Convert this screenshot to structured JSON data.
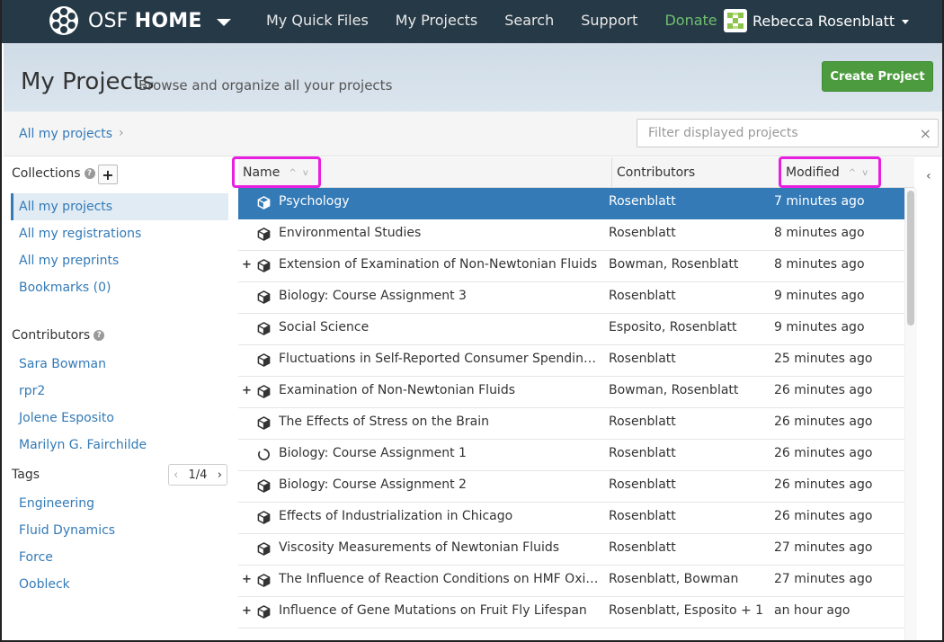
{
  "navbar": {
    "brand_prefix": "OSF ",
    "brand_strong": "HOME",
    "links": [
      "My Quick Files",
      "My Projects",
      "Search",
      "Support",
      "Donate"
    ],
    "user_name": "Rebecca Rosenblatt",
    "bg_color": "#263947",
    "donate_color": "#6fbf6f"
  },
  "header": {
    "title": "My Projects",
    "subtitle": "Browse and organize all your projects",
    "create_button": "Create Project",
    "create_color": "#4c9c3f"
  },
  "breadcrumb": {
    "current": "All my projects",
    "arrow": "›"
  },
  "filter": {
    "placeholder": "Filter displayed projects",
    "value": "",
    "clear_icon": "×"
  },
  "sidebar": {
    "collections_title": "Collections",
    "help_icon": "?",
    "add_icon": "+",
    "collections": [
      "All my projects",
      "All my registrations",
      "All my preprints",
      "Bookmarks (0)"
    ],
    "contributors_title": "Contributors",
    "contributors": [
      "Sara Bowman",
      "rpr2",
      "Jolene Esposito",
      "Marilyn G. Fairchilde"
    ],
    "tags_title": "Tags",
    "tags_pager": "1/4",
    "pager_prev": "‹",
    "pager_next": "›",
    "tags": [
      "Engineering",
      "Fluid Dynamics",
      "Force",
      "Oobleck"
    ]
  },
  "table": {
    "headers": {
      "name": "Name",
      "contributors": "Contributors",
      "modified": "Modified",
      "sort_icons": "^ v"
    },
    "collapse_icon": "‹",
    "highlight_color": "#e81ee0",
    "rows": [
      {
        "name": "Psychology",
        "contributors": "Rosenblatt",
        "modified": "7 minutes ago",
        "expand": "",
        "icon": "cube-icon",
        "selected": true
      },
      {
        "name": "Environmental Studies",
        "contributors": "Rosenblatt",
        "modified": "8 minutes ago",
        "expand": "",
        "icon": "cube-icon"
      },
      {
        "name": "Extension of Examination of Non-Newtonian Fluids",
        "contributors": "Bowman, Rosenblatt",
        "modified": "8 minutes ago",
        "expand": "+",
        "icon": "cube-icon"
      },
      {
        "name": "Biology: Course Assignment 3",
        "contributors": "Rosenblatt",
        "modified": "9 minutes ago",
        "expand": "",
        "icon": "cube-icon"
      },
      {
        "name": "Social Science",
        "contributors": "Esposito, Rosenblatt",
        "modified": "9 minutes ago",
        "expand": "",
        "icon": "cube-icon"
      },
      {
        "name": "Fluctuations in Self-Reported Consumer Spending in ...",
        "contributors": "Rosenblatt",
        "modified": "25 minutes ago",
        "expand": "",
        "icon": "cube-icon"
      },
      {
        "name": "Examination of Non-Newtonian Fluids",
        "contributors": "Bowman, Rosenblatt",
        "modified": "26 minutes ago",
        "expand": "+",
        "icon": "cube-icon"
      },
      {
        "name": "The Effects of Stress on the Brain",
        "contributors": "Rosenblatt",
        "modified": "26 minutes ago",
        "expand": "",
        "icon": "cube-icon"
      },
      {
        "name": "Biology: Course Assignment 1",
        "contributors": "Rosenblatt",
        "modified": "26 minutes ago",
        "expand": "",
        "icon": "loading-ring-icon"
      },
      {
        "name": "Biology: Course Assignment 2",
        "contributors": "Rosenblatt",
        "modified": "26 minutes ago",
        "expand": "",
        "icon": "cube-icon"
      },
      {
        "name": "Effects of Industrialization in Chicago",
        "contributors": "Rosenblatt",
        "modified": "26 minutes ago",
        "expand": "",
        "icon": "cube-icon"
      },
      {
        "name": "Viscosity Measurements of Newtonian Fluids",
        "contributors": "Rosenblatt",
        "modified": "27 minutes ago",
        "expand": "",
        "icon": "cube-icon"
      },
      {
        "name": "The Influence of Reaction Conditions on HMF Oxidati...",
        "contributors": "Rosenblatt, Bowman",
        "modified": "27 minutes ago",
        "expand": "+",
        "icon": "cube-icon"
      },
      {
        "name": "Influence of Gene Mutations on Fruit Fly Lifespan",
        "contributors": "Rosenblatt, Esposito + 1",
        "modified": "an hour ago",
        "expand": "+",
        "icon": "cube-icon"
      }
    ]
  }
}
